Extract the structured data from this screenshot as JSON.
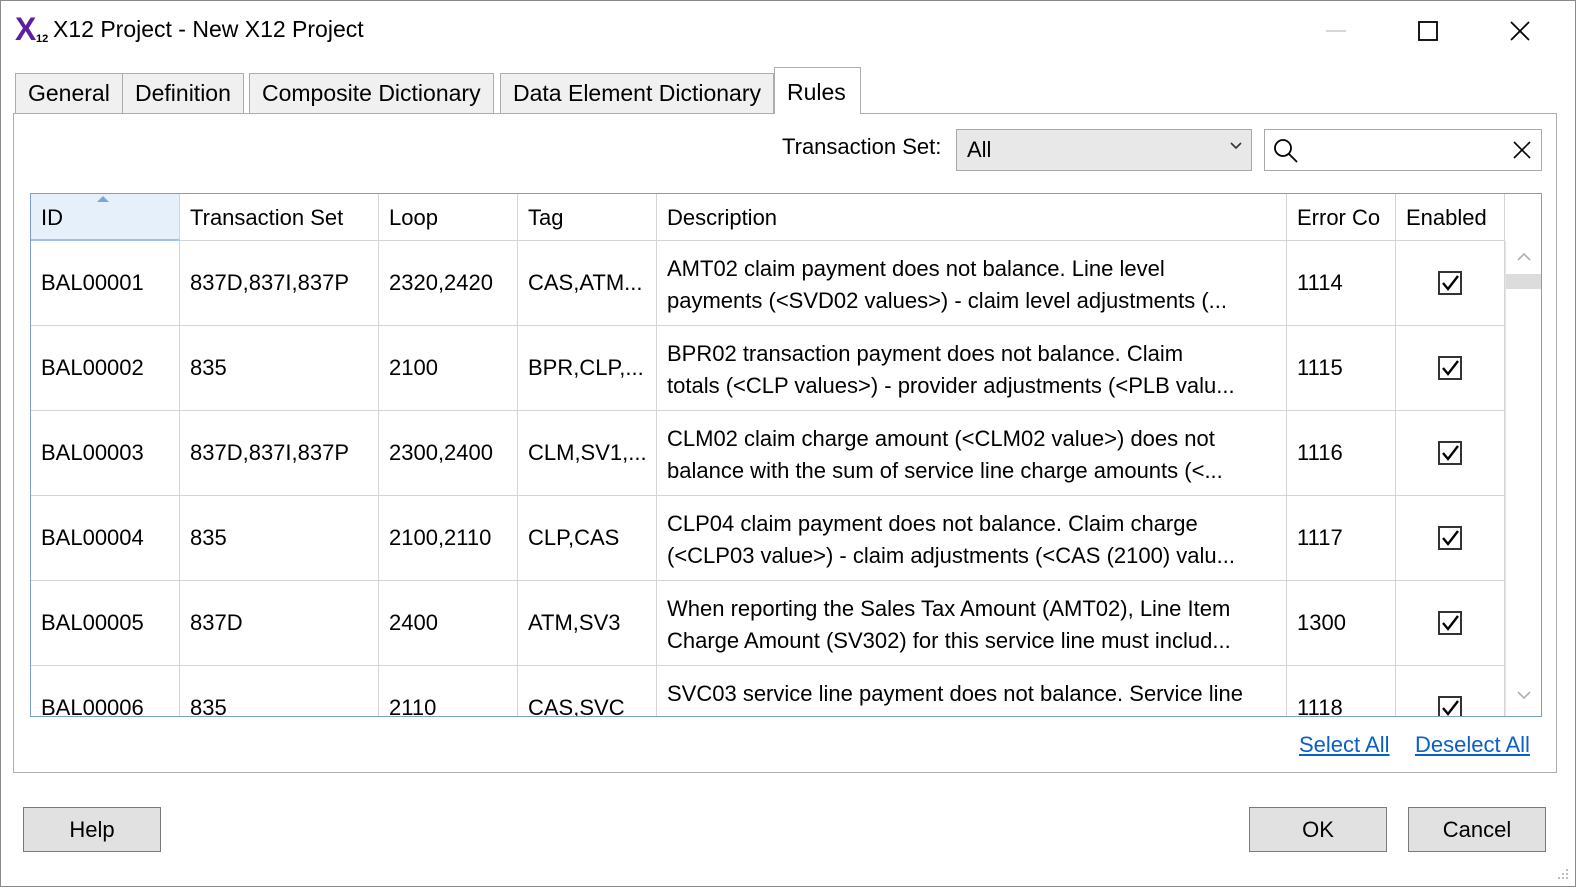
{
  "window": {
    "app_logo_text": "X",
    "app_logo_sub": "12",
    "title": "X12 Project - New X12 Project",
    "brand_color": "#5b1fa0"
  },
  "tabs": [
    {
      "label": "General",
      "active": false
    },
    {
      "label": "Definition",
      "active": false
    },
    {
      "label": "Composite Dictionary",
      "active": false
    },
    {
      "label": "Data Element Dictionary",
      "active": false
    },
    {
      "label": "Rules",
      "active": true
    }
  ],
  "filter": {
    "label": "Transaction Set:",
    "selected": "All",
    "search_value": ""
  },
  "grid": {
    "columns": [
      "ID",
      "Transaction Set",
      "Loop",
      "Tag",
      "Description",
      "Error Co",
      "Enabled"
    ],
    "sorted_column": "ID",
    "rows": [
      {
        "id": "BAL00001",
        "transaction_set": "837D,837I,837P",
        "loop": "2320,2420",
        "tag": "CAS,ATM...",
        "desc_line1": "AMT02 claim payment does not balance. Line level",
        "desc_line2": "payments (<SVD02 values>) - claim level adjustments (...",
        "error_code": "1114",
        "enabled": true
      },
      {
        "id": "BAL00002",
        "transaction_set": "835",
        "loop": "2100",
        "tag": "BPR,CLP,...",
        "desc_line1": "BPR02 transaction payment does not balance. Claim",
        "desc_line2": "totals (<CLP values>) - provider adjustments (<PLB valu...",
        "error_code": "1115",
        "enabled": true
      },
      {
        "id": "BAL00003",
        "transaction_set": "837D,837I,837P",
        "loop": "2300,2400",
        "tag": "CLM,SV1,...",
        "desc_line1": "CLM02 claim charge amount (<CLM02 value>) does not",
        "desc_line2": "balance with the sum of service line charge amounts (<...",
        "error_code": "1116",
        "enabled": true
      },
      {
        "id": "BAL00004",
        "transaction_set": "835",
        "loop": "2100,2110",
        "tag": "CLP,CAS",
        "desc_line1": "CLP04 claim payment does not balance. Claim charge",
        "desc_line2": "(<CLP03 value>) - claim adjustments (<CAS (2100) valu...",
        "error_code": "1117",
        "enabled": true
      },
      {
        "id": "BAL00005",
        "transaction_set": "837D",
        "loop": "2400",
        "tag": "ATM,SV3",
        "desc_line1": "When reporting the Sales Tax Amount (AMT02), Line Item",
        "desc_line2": "Charge Amount (SV302) for this service line must includ...",
        "error_code": "1300",
        "enabled": true
      },
      {
        "id": "BAL00006",
        "transaction_set": "835",
        "loop": "2110",
        "tag": "CAS,SVC",
        "desc_line1": "SVC03 service line payment does not balance. Service line",
        "desc_line2": "",
        "error_code": "1118",
        "enabled": true
      }
    ]
  },
  "links": {
    "select_all": "Select All",
    "deselect_all": "Deselect All"
  },
  "buttons": {
    "help": "Help",
    "ok": "OK",
    "cancel": "Cancel"
  },
  "icons": {
    "minimize": "minimize-icon",
    "maximize": "maximize-icon",
    "close": "close-icon",
    "dropdown": "chevron-down-icon",
    "search": "search-icon",
    "clear": "clear-icon",
    "sort": "sort-ascending-icon"
  }
}
